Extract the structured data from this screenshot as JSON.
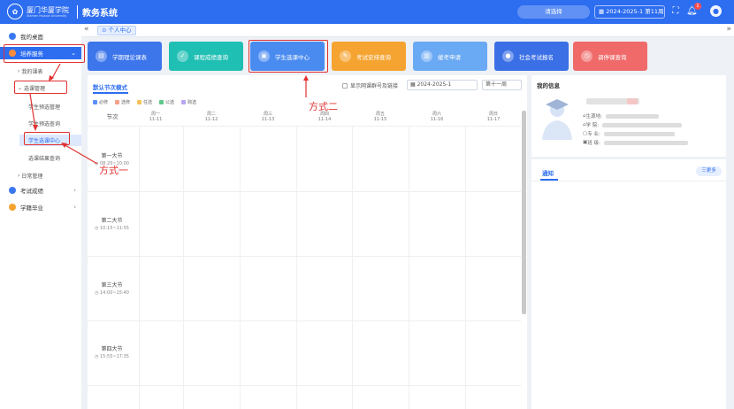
{
  "topbar": {
    "logo_text": "厦门华厦学院",
    "logo_sub": "Xiamen Huaxia University",
    "system_title": "教务系统",
    "search_placeholder": "请选择",
    "term_display": "2024-2025-1 第11周",
    "notification_count": "1",
    "colors": {
      "primary": "#2d6df0"
    }
  },
  "tagbar": {
    "home_tab": "个人中心"
  },
  "sidebar": {
    "items": [
      {
        "label": "我的桌面",
        "icon": "desktop-icon"
      },
      {
        "label": "培养服务",
        "icon": "training-icon"
      },
      {
        "label": "我的课表"
      },
      {
        "label": "选课管理"
      },
      {
        "label": "学生预选管理"
      },
      {
        "label": "学生预选查询"
      },
      {
        "label": "学生选课中心"
      },
      {
        "label": "选课结果查询"
      },
      {
        "label": "日常管理"
      },
      {
        "label": "考试成绩",
        "icon": "exam-icon"
      },
      {
        "label": "学籍毕业",
        "icon": "graduation-icon"
      }
    ]
  },
  "shortcuts": [
    {
      "label": "学期理论课表",
      "color": "#3d75ea"
    },
    {
      "label": "课程成绩查询",
      "color": "#20bfb4"
    },
    {
      "label": "学生选课中心",
      "color": "#4a8bf0"
    },
    {
      "label": "考试安排查询",
      "color": "#f5a431"
    },
    {
      "label": "缓考申请",
      "color": "#6aa9f3"
    },
    {
      "label": "社会考试报名",
      "color": "#3b6fe6"
    },
    {
      "label": "调停课查询",
      "color": "#f06a6a"
    }
  ],
  "schedule": {
    "title": "默认节次模式",
    "option_label": "显示网课群号及链接",
    "term": "2024-2025-1",
    "week": "第十一周",
    "legend": [
      {
        "label": "必修",
        "color": "#5b8ff9"
      },
      {
        "label": "选修",
        "color": "#f4a18a"
      },
      {
        "label": "任选",
        "color": "#f5c15a"
      },
      {
        "label": "公选",
        "color": "#5fc98b"
      },
      {
        "label": "跨选",
        "color": "#b9a6f0"
      }
    ],
    "period_header": "节次",
    "days": [
      {
        "name": "周一",
        "date": "11-11"
      },
      {
        "name": "周二",
        "date": "11-12"
      },
      {
        "name": "周三",
        "date": "11-13"
      },
      {
        "name": "周四",
        "date": "11-14"
      },
      {
        "name": "周五",
        "date": "11-15"
      },
      {
        "name": "周六",
        "date": "11-16"
      },
      {
        "name": "周日",
        "date": "11-17"
      }
    ],
    "periods": [
      {
        "name": "第一大节",
        "time": "08:20~10:00"
      },
      {
        "name": "第二大节",
        "time": "10:15~11:55"
      },
      {
        "name": "第三大节",
        "time": "14:00~15:40"
      },
      {
        "name": "第四大节",
        "time": "15:55~17:35"
      }
    ]
  },
  "info": {
    "title": "我的信息",
    "rows": [
      "生源地:",
      "学 院:",
      "专 业:",
      "班 级:"
    ]
  },
  "notice": {
    "tab": "通知",
    "more": "三更多"
  },
  "annotations": {
    "method1": "方式一",
    "method2": "方式二"
  }
}
